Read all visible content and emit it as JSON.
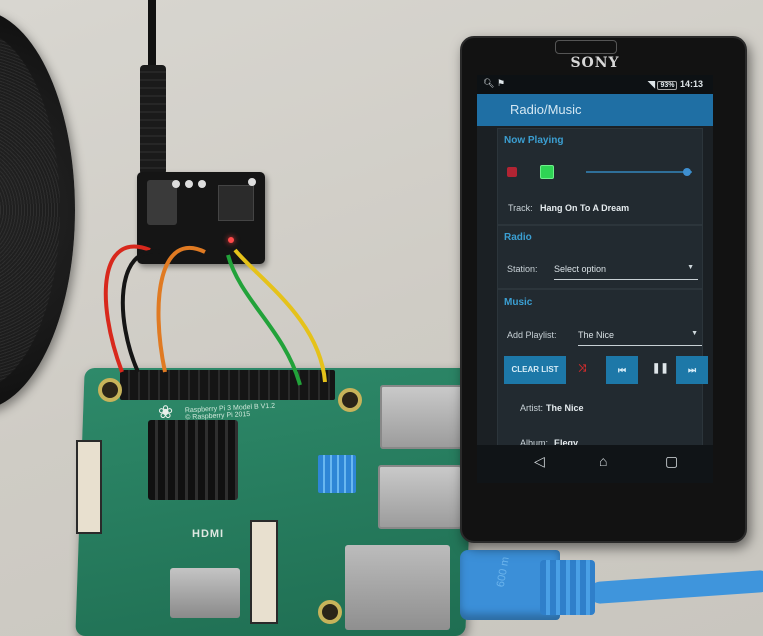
{
  "scene": {
    "description": "Photo of a Raspberry Pi 3 with a DAC board wired to its GPIO header, next to a Sony smartphone running a Radio/Music control app",
    "phone_brand": "SONY",
    "rpi_board_text": [
      "Raspberry Pi 3 Model B V1.2",
      "© Raspberry Pi 2015"
    ],
    "rpi_port_label": "HDMI",
    "ethernet_cable_label": "600 m",
    "colors": {
      "rpi_pcb": "#2e8a6a",
      "ethernet_cable": "#3b8fd8",
      "heatsink_blue": "#2e86d6",
      "wire_red": "#d8281c",
      "wire_black": "#151515",
      "wire_orange": "#e07a22",
      "wire_green": "#22a23a",
      "wire_yellow": "#e5c21a"
    }
  },
  "phone": {
    "statusbar": {
      "left_icons": [
        "search-icon",
        "notification-icon"
      ],
      "battery": "93%",
      "time": "14:13"
    },
    "appbar": {
      "title": "Radio/Music"
    },
    "accent_color": "#1f6fa4",
    "now_playing": {
      "section_title": "Now Playing",
      "volume_level_fraction": 0.95,
      "track_label": "Track:",
      "track_value": "Hang On To A Dream"
    },
    "radio": {
      "section_title": "Radio",
      "station_label": "Station:",
      "station_value": "Select option"
    },
    "music": {
      "section_title": "Music",
      "playlist_label": "Add Playlist:",
      "playlist_value": "The Nice",
      "clear_list_label": "CLEAR LIST",
      "shuffle_glyph": "⤨",
      "prev_glyph": "⏮",
      "pause_glyph": "❚❚",
      "next_glyph": "⏭",
      "artist_label": "Artist:",
      "artist_value": "The Nice",
      "album_label": "Album:",
      "album_value": "Elegy"
    },
    "navbar": {
      "back_glyph": "◁",
      "home_glyph": "⌂",
      "recents_glyph": "▢"
    }
  }
}
